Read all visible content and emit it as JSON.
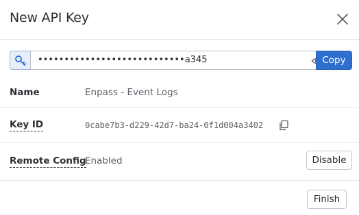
{
  "dialog": {
    "title": "New API Key",
    "close_icon": "close-icon"
  },
  "api_key": {
    "icon": "key-icon",
    "masked_value": "••••••••••••••••••••••••••••a345",
    "reveal_icon": "eye-icon",
    "copy_label": "Copy"
  },
  "fields": {
    "name": {
      "label": "Name",
      "value": "Enpass - Event Logs"
    },
    "key_id": {
      "label": "Key ID",
      "value": "0cabe7b3-d229-42d7-ba24-0f1d004a3402",
      "copy_icon": "copy-icon"
    },
    "remote_config": {
      "label": "Remote Config",
      "value": "Enabled",
      "action_label": "Disable"
    }
  },
  "footer": {
    "finish_label": "Finish"
  },
  "colors": {
    "accent": "#2f6fce",
    "key_icon_bg": "#e6eef9",
    "divider": "#e6e6e9"
  }
}
